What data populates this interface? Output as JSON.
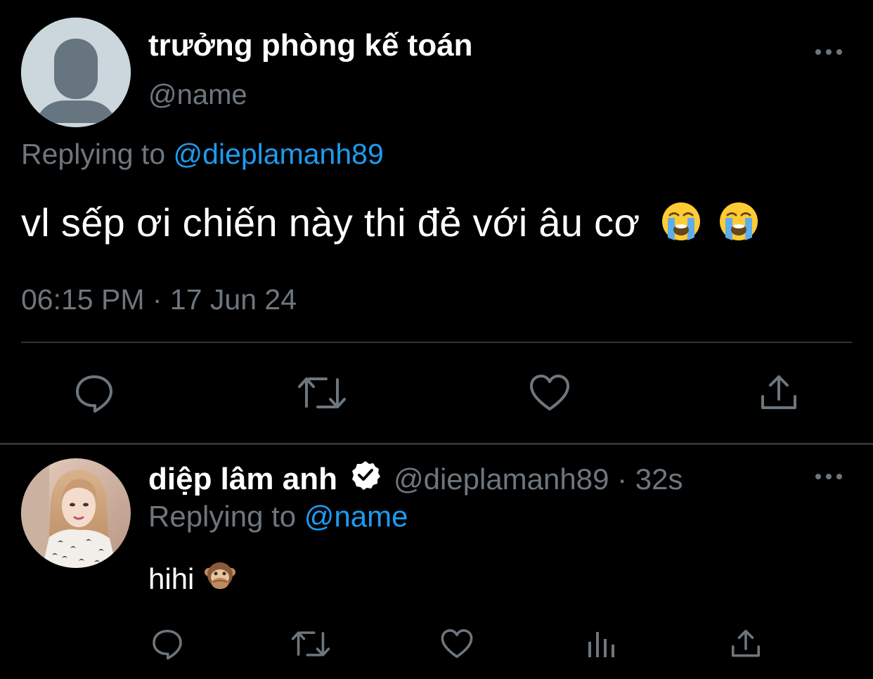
{
  "main_tweet": {
    "display_name": "trưởng phòng kế toán",
    "handle": "@name",
    "replying_prefix": "Replying to",
    "replying_handle": "@dieplamanh89",
    "text": "vl sếp ơi chiến này thi đẻ với âu cơ",
    "emojis": [
      "loudly-crying-face",
      "loudly-crying-face"
    ],
    "timestamp": "06:15 PM · 17 Jun 24",
    "actions": [
      "reply-icon",
      "retweet-icon",
      "like-icon",
      "share-icon"
    ]
  },
  "reply_tweet": {
    "display_name": "diệp lâm anh",
    "verified": true,
    "handle_time": "@dieplamanh89 · 32s",
    "replying_prefix": "Replying to",
    "replying_handle": "@name",
    "text": "hihi",
    "emoji": "speak-no-evil-monkey",
    "actions": [
      "reply-icon",
      "retweet-icon",
      "like-icon",
      "views-icon",
      "share-icon"
    ]
  },
  "colors": {
    "background": "#000000",
    "text_primary": "#ffffff",
    "text_secondary": "#6e767d",
    "link": "#1d9bf0",
    "divider": "#2f3336"
  }
}
